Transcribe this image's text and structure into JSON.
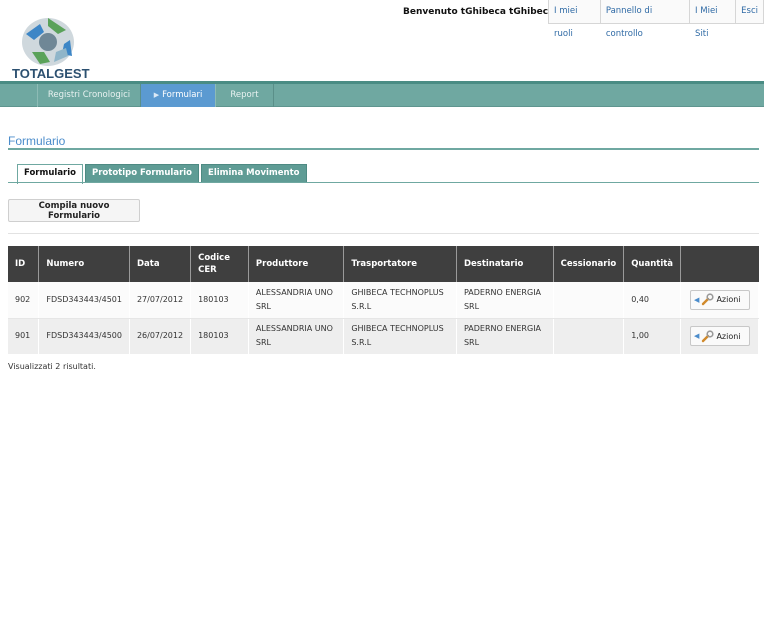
{
  "header": {
    "logo_text": "TOTALGEST",
    "welcome": "Benvenuto tGhibeca tGhibeca!",
    "links": [
      "I miei ruoli",
      "Pannello di controllo",
      "I Miei Siti",
      "Esci"
    ]
  },
  "nav": {
    "items": [
      "Registri Cronologici",
      "Formulari",
      "Report"
    ],
    "active": "Formulari"
  },
  "page": {
    "title": "Formulario"
  },
  "tabs": [
    "Formulario",
    "Prototipo Formulario",
    "Elimina Movimento"
  ],
  "actions": {
    "new_button": "Compila nuovo Formulario"
  },
  "table": {
    "headers": [
      "ID",
      "Numero",
      "Data",
      "Codice CER",
      "Produttore",
      "Trasportatore",
      "Destinatario",
      "Cessionario",
      "Quantità",
      ""
    ],
    "rows": [
      {
        "id": "902",
        "numero": "FDSD343443/4501",
        "data": "27/07/2012",
        "cer": "180103",
        "produttore": "ALESSANDRIA UNO SRL",
        "trasportatore": "GHIBECA TECHNOPLUS S.R.L",
        "destinatario": "PADERNO ENERGIA SRL",
        "cessionario": "",
        "quantita": "0,40",
        "azioni": "Azioni"
      },
      {
        "id": "901",
        "numero": "FDSD343443/4500",
        "data": "26/07/2012",
        "cer": "180103",
        "produttore": "ALESSANDRIA UNO SRL",
        "trasportatore": "GHIBECA TECHNOPLUS S.R.L",
        "destinatario": "PADERNO ENERGIA SRL",
        "cessionario": "",
        "quantita": "1,00",
        "azioni": "Azioni"
      }
    ]
  },
  "footer": {
    "results": "Visualizzati 2 risultati."
  },
  "icons": {
    "logo": "recycle-logo-icon",
    "nav_active": "triangle-right-icon",
    "action_caret": "caret-left-icon",
    "action_tool": "wrench-icon"
  },
  "colors": {
    "nav_bg": "#6fa8a1",
    "nav_active": "#5b9ad1",
    "title": "#4b8ccb",
    "table_header": "#3f3f3f",
    "tab_inactive": "#5f9c95"
  }
}
